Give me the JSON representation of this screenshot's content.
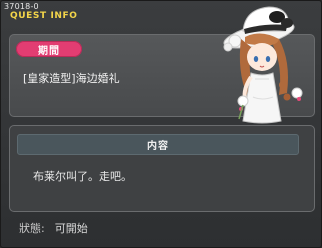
{
  "header": {
    "quest_id": "37018-0",
    "title": "QUEST INFO"
  },
  "period": {
    "badge_label": "期間",
    "event_name": "[皇家造型]海边婚礼"
  },
  "content": {
    "header_label": "内容",
    "dialog": "布莱尔叫了。走吧。"
  },
  "status": {
    "label": "狀態:",
    "value": "可開始"
  },
  "colors": {
    "title_yellow": "#f3d54a",
    "badge_pink": "#e23d72",
    "panel_bg": "#484a4c",
    "content_header": "#4a565c"
  },
  "icons": {
    "portrait": "npc-bride-portrait-icon"
  }
}
